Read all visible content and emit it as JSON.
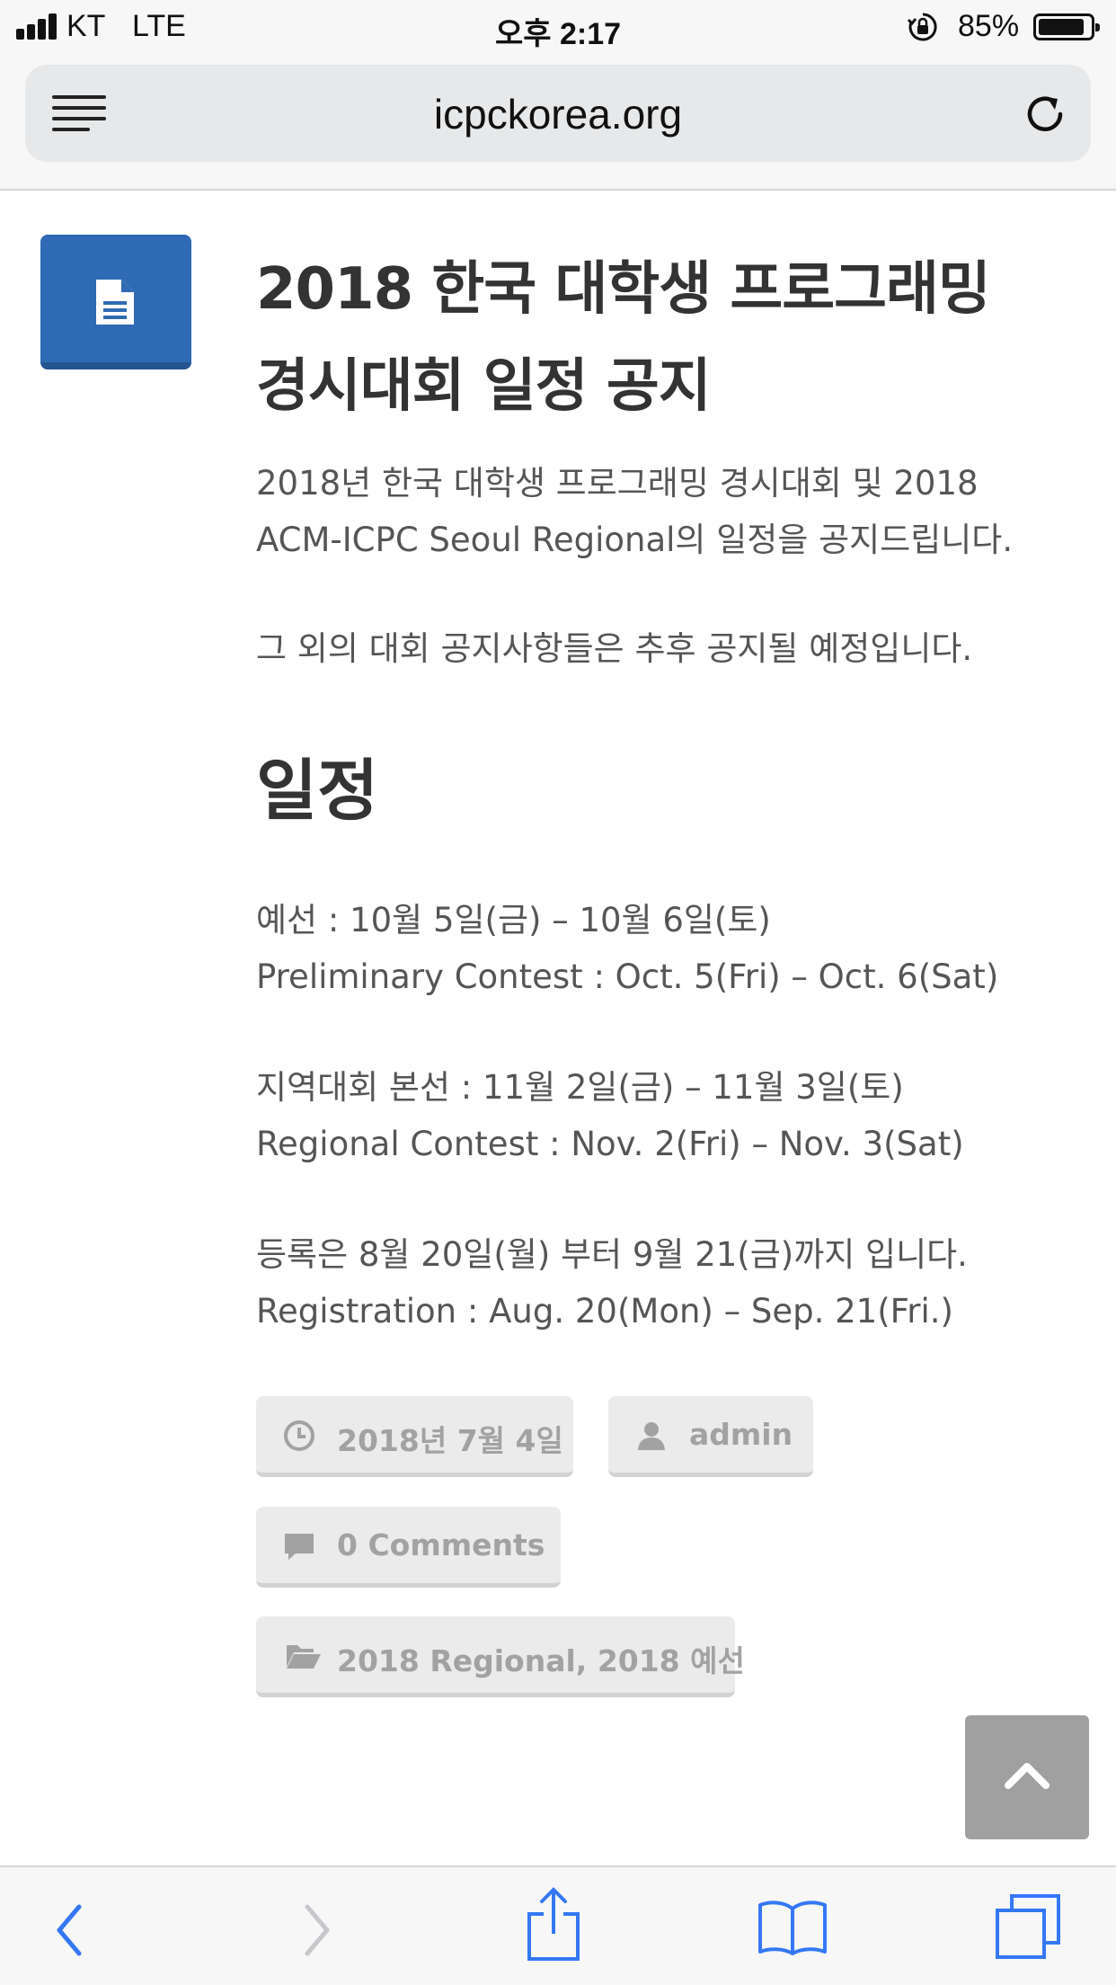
{
  "status_bar": {
    "carrier": "KT",
    "network": "LTE",
    "time": "오후 2:17",
    "battery_percent": "85%",
    "battery_level": 0.85,
    "icons": [
      "signal-icon",
      "orientation-lock-icon",
      "battery-icon"
    ]
  },
  "browser": {
    "url": "icpckorea.org",
    "icons": [
      "menu-icon",
      "reload-icon"
    ]
  },
  "post": {
    "title_line1": "2018 한국 대학생 프로그래밍",
    "title_line2": "경시대회 일정 공지",
    "intro_line1": "2018년 한국 대학생 프로그래밍 경시대회 및 2018",
    "intro_line2": "ACM-ICPC Seoul Regional의 일정을 공지드립니다.",
    "note": "그 외의 대회 공지사항들은 추후 공지될 예정입니다.",
    "section_heading": "일정",
    "schedule": [
      {
        "ko": "예선 : 10월 5일(금) – 10월 6일(토)",
        "en": "Preliminary Contest : Oct. 5(Fri) – Oct. 6(Sat)"
      },
      {
        "ko": "지역대회 본선 : 11월 2일(금) – 11월 3일(토)",
        "en": "Regional Contest : Nov. 2(Fri) – Nov. 3(Sat)"
      },
      {
        "ko": "등록은 8월 20일(월) 부터 9월 21(금)까지 입니다.",
        "en": "Registration : Aug. 20(Mon) – Sep. 21(Fri.)"
      }
    ]
  },
  "meta": {
    "date": "2018년 7월 4일",
    "author": "admin",
    "comments": "0 Comments",
    "categories": "2018 Regional, 2018 예선"
  },
  "colors": {
    "accent": "#2f6ab4",
    "pill_background": "#ebebeb",
    "pill_text": "#a2a2a2",
    "ios_blue": "#3478f6"
  },
  "toolbar": {
    "icons": [
      "back-icon",
      "forward-icon",
      "share-icon",
      "bookmarks-icon",
      "tabs-icon"
    ],
    "forward_enabled": false
  }
}
